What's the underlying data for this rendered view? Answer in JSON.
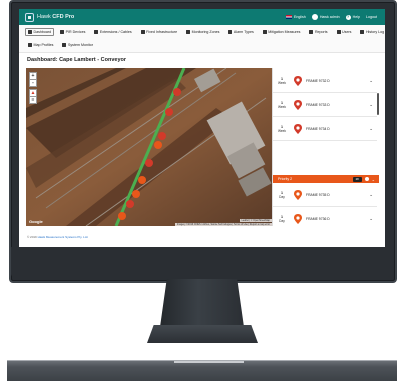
{
  "app": {
    "name_prefix": "Hawk",
    "name_suffix": "CFD Pro"
  },
  "topbar": {
    "language": "English",
    "user": "Hawk admin",
    "help": "Help",
    "logout": "Logout"
  },
  "nav": {
    "row1": [
      {
        "label": "Dashboard",
        "icon": "home-icon",
        "active": true
      },
      {
        "label": "PIR Devices",
        "icon": "device-icon"
      },
      {
        "label": "Extensions / Cables",
        "icon": "cable-icon"
      },
      {
        "label": "Fixed Infrastructure",
        "icon": "building-icon"
      },
      {
        "label": "Monitoring Zones",
        "icon": "target-icon"
      },
      {
        "label": "Alarm Types",
        "icon": "alarm-icon"
      },
      {
        "label": "Mitigation Measures",
        "icon": "shield-icon"
      },
      {
        "label": "Reports",
        "icon": "chart-icon"
      },
      {
        "label": "Users",
        "icon": "users-icon"
      },
      {
        "label": "History Log",
        "icon": "history-icon"
      }
    ],
    "row2": [
      {
        "label": "Map Profiles",
        "icon": "map-icon"
      },
      {
        "label": "System Monitor",
        "icon": "monitor-icon"
      }
    ]
  },
  "dashboard": {
    "title": "Dashboard: Cape Lambert - Conveyor"
  },
  "map": {
    "zoom_in": "+",
    "zoom_out": "-",
    "google": "Google",
    "attribution": "Leaflet | © OpenStreetMap",
    "imagery": "Imagery ©2019 CNES / Airbus, Sainte Technologies | Terms of Use | Report a map error"
  },
  "alerts": [
    {
      "age_num": "1",
      "age_unit": "Week",
      "frame": "FRAME 9732 D",
      "color": "#d23a2a"
    },
    {
      "age_num": "1",
      "age_unit": "Week",
      "frame": "FRAME 9733 D",
      "color": "#d23a2a"
    },
    {
      "age_num": "1",
      "age_unit": "Week",
      "frame": "FRAME 9734 D",
      "color": "#d23a2a"
    }
  ],
  "priority": {
    "label": "Priority 2",
    "badge": "28"
  },
  "alerts2": [
    {
      "age_num": "1",
      "age_unit": "Day",
      "frame": "FRAME 9735 D",
      "color": "#e8571a"
    },
    {
      "age_num": "1",
      "age_unit": "Day",
      "frame": "FRAME 9736 D",
      "color": "#e8571a"
    },
    {
      "age_num": "1",
      "age_unit": "Day",
      "frame": "FRAME 9737 D",
      "color": "#e8571a"
    }
  ],
  "footer": {
    "text": "© 2019",
    "company": "Hawk Measurement Systems Pty. Ltd."
  }
}
